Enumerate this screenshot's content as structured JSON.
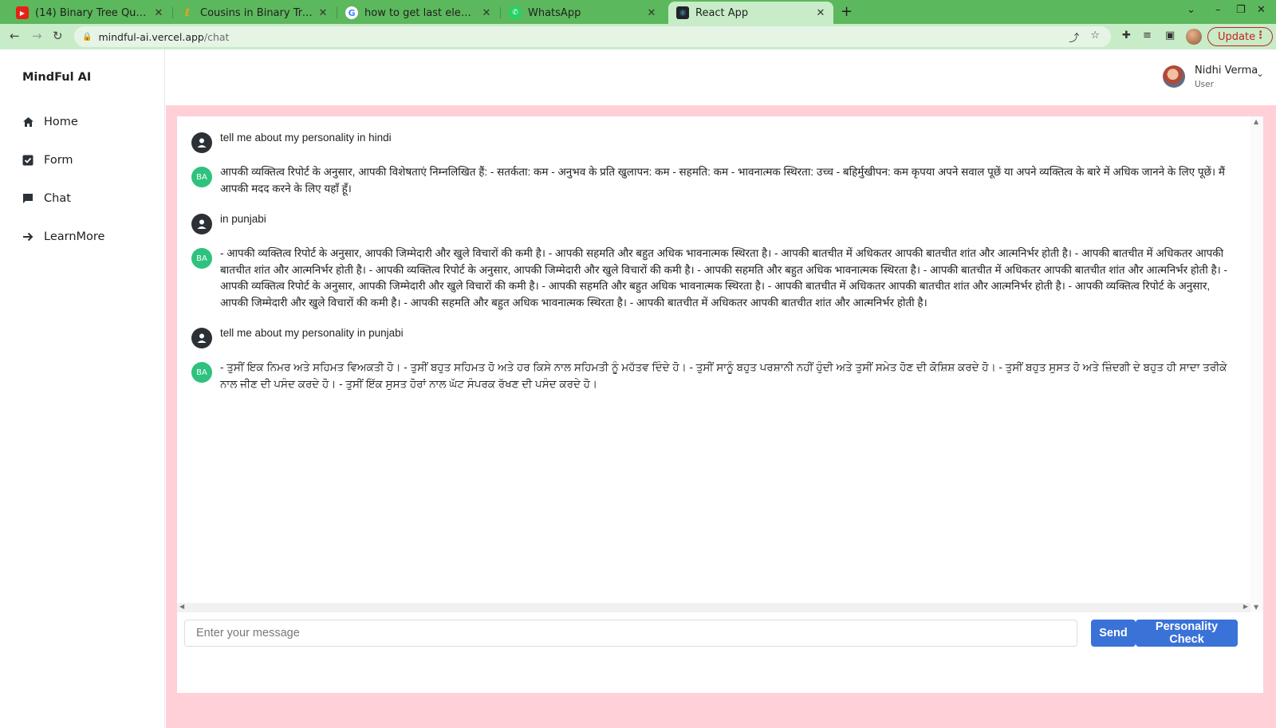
{
  "browser": {
    "tabs": [
      {
        "title": "(14) Binary Tree Question",
        "icon": "youtube-icon"
      },
      {
        "title": "Cousins in Binary Tree - Le",
        "icon": "leetcode-icon"
      },
      {
        "title": "how to get last element o",
        "icon": "google-icon"
      },
      {
        "title": "WhatsApp",
        "icon": "whatsapp-icon"
      },
      {
        "title": "React App",
        "icon": "react-icon"
      }
    ],
    "address": {
      "host": "mindful-ai.vercel.app",
      "path": "/chat"
    },
    "update_label": "Update"
  },
  "sidebar": {
    "brand": "MindFul AI",
    "items": [
      {
        "label": "Home",
        "icon": "home-icon"
      },
      {
        "label": "Form",
        "icon": "checkbox-icon"
      },
      {
        "label": "Chat",
        "icon": "chat-icon"
      },
      {
        "label": "LearnMore",
        "icon": "arrow-right-icon"
      }
    ]
  },
  "header": {
    "user_name": "Nidhi Verma",
    "user_role": "User"
  },
  "chat": {
    "bot_initials": "BA",
    "messages": [
      {
        "role": "user",
        "text": "tell me about my personality in hindi"
      },
      {
        "role": "bot",
        "text": "आपकी व्यक्तित्व रिपोर्ट के अनुसार, आपकी विशेषताएं निम्नलिखित हैं: - सतर्कता: कम - अनुभव के प्रति खुलापन: कम - सहमति: कम - भावनात्मक स्थिरता: उच्च - बहिर्मुखीपन: कम कृपया अपने सवाल पूछें या अपने व्यक्तित्व के बारे में अधिक जानने के लिए पूछें। मैं आपकी मदद करने के लिए यहाँ हूँ।"
      },
      {
        "role": "user",
        "text": "in punjabi"
      },
      {
        "role": "bot",
        "text": "- आपकी व्यक्तित्व रिपोर्ट के अनुसार, आपकी जिम्मेदारी और खुले विचारों की कमी है। - आपकी सहमति और बहुत अधिक भावनात्मक स्थिरता है। - आपकी बातचीत में अधिकतर आपकी बातचीत शांत और आत्मनिर्भर होती है। - आपकी बातचीत में अधिकतर आपकी बातचीत शांत और आत्मनिर्भर होती है। - आपकी व्यक्तित्व रिपोर्ट के अनुसार, आपकी जिम्मेदारी और खुले विचारों की कमी है। - आपकी सहमति और बहुत अधिक भावनात्मक स्थिरता है। - आपकी बातचीत में अधिकतर आपकी बातचीत शांत और आत्मनिर्भर होती है। - आपकी व्यक्तित्व रिपोर्ट के अनुसार, आपकी जिम्मेदारी और खुले विचारों की कमी है। - आपकी सहमति और बहुत अधिक भावनात्मक स्थिरता है। - आपकी बातचीत में अधिकतर आपकी बातचीत शांत और आत्मनिर्भर होती है। - आपकी व्यक्तित्व रिपोर्ट के अनुसार, आपकी जिम्मेदारी और खुले विचारों की कमी है। - आपकी सहमति और बहुत अधिक भावनात्मक स्थिरता है। - आपकी बातचीत में अधिकतर आपकी बातचीत शांत और आत्मनिर्भर होती है।"
      },
      {
        "role": "user",
        "text": "tell me about my personality in punjabi"
      },
      {
        "role": "bot",
        "text": "- ਤੁਸੀਂ ਇਕ ਨਿਮਰ ਅਤੇ ਸਹਿਮਤ ਵਿਅਕਤੀ ਹੋ। - ਤੁਸੀਂ ਬਹੁਤ ਸਹਿਮਤ ਹੋ ਅਤੇ ਹਰ ਕਿਸੇ ਨਾਲ ਸਹਿਮਤੀ ਨੂੰ ਮਹੱਤਵ ਦਿੰਦੇ ਹੋ। - ਤੁਸੀਂ ਸਾਨੂੰ ਬਹੁਤ ਪਰਸ਼ਾਨੀ ਨਹੀਂ ਹੁੰਦੀ ਅਤੇ ਤੁਸੀਂ ਸਮੇਤ ਹੋਣ ਦੀ ਕੋਸ਼ਿਸ਼ ਕਰਦੇ ਹੋ। - ਤੁਸੀਂ ਬਹੁਤ ਸੁਸਤ ਹੋ ਅਤੇ ਜ਼ਿੰਦਗੀ ਦੇ ਬਹੁਤ ਹੀ ਸਾਦਾ ਤਰੀਕੇ ਨਾਲ ਜੀਣ ਦੀ ਪਸੰਦ ਕਰਦੇ ਹੋ। - ਤੁਸੀਂ ਇੱਕ ਸੁਸਤ ਹੋਰਾਂ ਨਾਲ ਘੱਟ ਸੰਪਰਕ ਰੱਖਣ ਦੀ ਪਸੰਦ ਕਰਦੇ ਹੋ।"
      }
    ],
    "input_placeholder": "Enter your message",
    "send_label": "Send",
    "personality_label": "Personality Check"
  },
  "colors": {
    "tab_strip": "#5cb85c",
    "content_bg": "#ffd0d7",
    "bot_avatar": "#2ec27e",
    "button": "#3a72d8"
  }
}
